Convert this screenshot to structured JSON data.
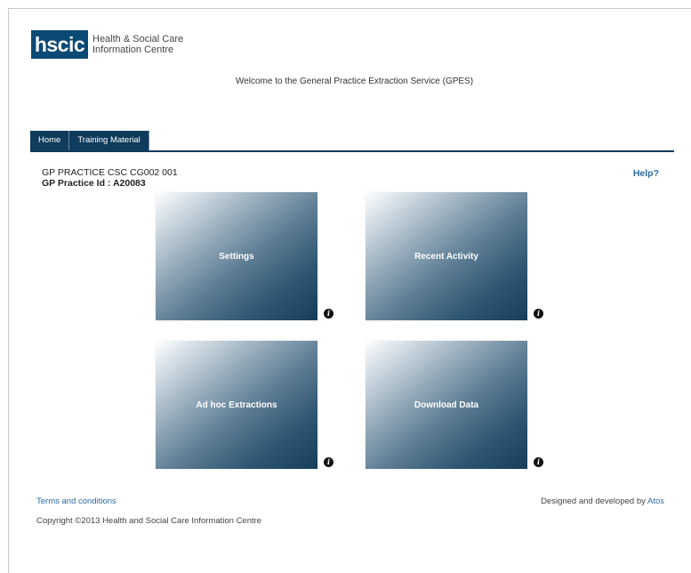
{
  "header": {
    "logo_mark": "hscic",
    "org_line1": "Health & Social Care",
    "org_line2": "Information Centre",
    "welcome": "Welcome to the General Practice Extraction Service (GPES)"
  },
  "nav": {
    "tabs": [
      {
        "label": "Home"
      },
      {
        "label": "Training Material"
      }
    ]
  },
  "practice": {
    "name": "GP PRACTICE CSC CG002 001",
    "id_label": "GP Practice Id : A20083"
  },
  "help_label": "Help?",
  "tiles": [
    {
      "label": "Settings",
      "info_icon": "info-icon"
    },
    {
      "label": "Recent Activity",
      "info_icon": "info-icon"
    },
    {
      "label": "Ad hoc Extractions",
      "info_icon": "info-icon"
    },
    {
      "label": "Download Data",
      "info_icon": "info-icon"
    }
  ],
  "footer": {
    "terms": "Terms and conditions",
    "designed_prefix": "Designed and developed by",
    "designed_link": "Atos",
    "copyright": "Copyright ©2013 Health and Social Care Information Centre"
  },
  "colors": {
    "brand": "#0b4a75",
    "nav": "#0f3b5c",
    "link": "#2a6aa3"
  }
}
